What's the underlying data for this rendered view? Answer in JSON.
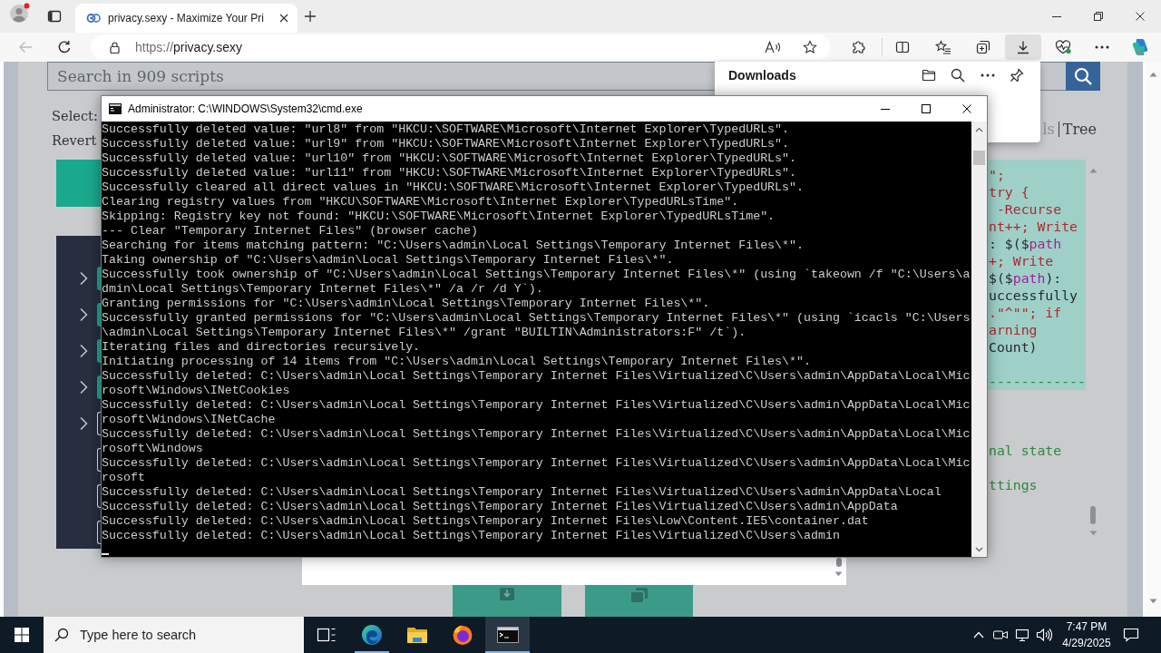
{
  "browser": {
    "tabs": [
      {
        "title": "privacy.sexy - Maximize Your Pri",
        "selected": true
      }
    ],
    "back_button": {
      "disabled": true
    },
    "address_bar": {
      "scheme": "https://",
      "host": "privacy.sexy"
    },
    "downloads_button": {
      "selected": true
    },
    "downloads_panel": {
      "title": "Downloads"
    }
  },
  "page": {
    "search": {
      "placeholder": "Search in 909 scripts"
    },
    "select_label": "Select:",
    "revert_label": "Revert",
    "view_options": [
      {
        "label": "ls",
        "selected": true
      },
      {
        "label": "Tree",
        "selected": false
      }
    ],
    "script_rows": [
      {
        "kind": "category",
        "checked": true
      },
      {
        "kind": "category",
        "checked": true
      },
      {
        "kind": "category",
        "checked": true
      },
      {
        "kind": "category",
        "checked": true
      },
      {
        "kind": "category",
        "checked": false
      },
      {
        "kind": "script",
        "checked": false
      },
      {
        "kind": "script",
        "checked": false
      },
      {
        "kind": "script",
        "checked": false
      }
    ],
    "code_lines": [
      {
        "kind": "code",
        "highlighted": true,
        "tokens": [
          {
            "text": "\";",
            "kind": "string"
          }
        ]
      },
      {
        "kind": "code",
        "highlighted": true,
        "tokens": [
          {
            "text": "try {",
            "kind": "string"
          }
        ]
      },
      {
        "kind": "code",
        "highlighted": true,
        "tokens": [
          {
            "text": " -Recurse",
            "kind": "string"
          }
        ]
      },
      {
        "kind": "code",
        "highlighted": true,
        "tokens": [
          {
            "text": "nt++; Write",
            "kind": "string"
          }
        ]
      },
      {
        "kind": "code",
        "highlighted": true,
        "tokens": [
          {
            "text": ": $($",
            "kind": "plain"
          },
          {
            "text": "path",
            "kind": "variable"
          }
        ]
      },
      {
        "kind": "code",
        "highlighted": true,
        "tokens": [
          {
            "text": "+; Write",
            "kind": "string"
          }
        ]
      },
      {
        "kind": "code",
        "highlighted": true,
        "tokens": [
          {
            "text": "$($",
            "kind": "plain"
          },
          {
            "text": "path",
            "kind": "variable"
          },
          {
            "text": "):",
            "kind": "plain"
          }
        ]
      },
      {
        "kind": "code",
        "highlighted": true,
        "tokens": [
          {
            "text": "uccessfully",
            "kind": "plain"
          }
        ]
      },
      {
        "kind": "code",
        "highlighted": true,
        "tokens": [
          {
            "text": ".\"^\"\"; if",
            "kind": "string"
          }
        ]
      },
      {
        "kind": "code",
        "highlighted": true,
        "tokens": [
          {
            "text": "arning",
            "kind": "string"
          }
        ]
      },
      {
        "kind": "code",
        "highlighted": true,
        "tokens": [
          {
            "text": "Count)",
            "kind": "plain"
          }
        ]
      },
      {
        "kind": "hidden",
        "highlighted": true
      },
      {
        "kind": "code",
        "highlighted": true,
        "tokens": [
          {
            "text": "------------",
            "kind": "comment"
          }
        ]
      },
      {
        "kind": "hidden",
        "highlighted": false
      },
      {
        "kind": "hidden",
        "highlighted": false
      },
      {
        "kind": "hidden",
        "highlighted": false
      },
      {
        "kind": "code",
        "highlighted": false,
        "tokens": [
          {
            "text": "nal state",
            "kind": "comment"
          }
        ]
      },
      {
        "kind": "hidden",
        "highlighted": false
      },
      {
        "kind": "code",
        "highlighted": false,
        "tokens": [
          {
            "text": "ttings",
            "kind": "comment"
          }
        ]
      }
    ]
  },
  "cmd_window": {
    "title": "Administrator: C:\\WINDOWS\\System32\\cmd.exe",
    "cursor_visible": true,
    "lines": [
      "Successfully deleted value: \"url8\" from \"HKCU:\\SOFTWARE\\Microsoft\\Internet Explorer\\TypedURLs\".",
      "Successfully deleted value: \"url9\" from \"HKCU:\\SOFTWARE\\Microsoft\\Internet Explorer\\TypedURLs\".",
      "Successfully deleted value: \"url10\" from \"HKCU:\\SOFTWARE\\Microsoft\\Internet Explorer\\TypedURLs\".",
      "Successfully deleted value: \"url11\" from \"HKCU:\\SOFTWARE\\Microsoft\\Internet Explorer\\TypedURLs\".",
      "Successfully cleared all direct values in \"HKCU:\\SOFTWARE\\Microsoft\\Internet Explorer\\TypedURLs\".",
      "Clearing registry values from \"HKCU\\SOFTWARE\\Microsoft\\Internet Explorer\\TypedURLsTime\".",
      "Skipping: Registry key not found: \"HKCU:\\SOFTWARE\\Microsoft\\Internet Explorer\\TypedURLsTime\".",
      "--- Clear \"Temporary Internet Files\" (browser cache)",
      "Searching for items matching pattern: \"C:\\Users\\admin\\Local Settings\\Temporary Internet Files\\*\".",
      "Taking ownership of \"C:\\Users\\admin\\Local Settings\\Temporary Internet Files\\*\".",
      "Successfully took ownership of \"C:\\Users\\admin\\Local Settings\\Temporary Internet Files\\*\" (using `takeown /f \"C:\\Users\\a",
      "dmin\\Local Settings\\Temporary Internet Files\\*\" /a /r /d Y`).",
      "Granting permissions for \"C:\\Users\\admin\\Local Settings\\Temporary Internet Files\\*\".",
      "Successfully granted permissions for \"C:\\Users\\admin\\Local Settings\\Temporary Internet Files\\*\" (using `icacls \"C:\\Users",
      "\\admin\\Local Settings\\Temporary Internet Files\\*\" /grant \"BUILTIN\\Administrators:F\" /t`).",
      "Iterating files and directories recursively.",
      "Initiating processing of 14 items from \"C:\\Users\\admin\\Local Settings\\Temporary Internet Files\\*\".",
      "Successfully deleted: C:\\Users\\admin\\Local Settings\\Temporary Internet Files\\Virtualized\\C\\Users\\admin\\AppData\\Local\\Mic",
      "rosoft\\Windows\\INetCookies",
      "Successfully deleted: C:\\Users\\admin\\Local Settings\\Temporary Internet Files\\Virtualized\\C\\Users\\admin\\AppData\\Local\\Mic",
      "rosoft\\Windows\\INetCache",
      "Successfully deleted: C:\\Users\\admin\\Local Settings\\Temporary Internet Files\\Virtualized\\C\\Users\\admin\\AppData\\Local\\Mic",
      "rosoft\\Windows",
      "Successfully deleted: C:\\Users\\admin\\Local Settings\\Temporary Internet Files\\Virtualized\\C\\Users\\admin\\AppData\\Local\\Mic",
      "rosoft",
      "Successfully deleted: C:\\Users\\admin\\Local Settings\\Temporary Internet Files\\Virtualized\\C\\Users\\admin\\AppData\\Local",
      "Successfully deleted: C:\\Users\\admin\\Local Settings\\Temporary Internet Files\\Virtualized\\C\\Users\\admin\\AppData",
      "Successfully deleted: C:\\Users\\admin\\Local Settings\\Temporary Internet Files\\Low\\Content.IE5\\container.dat",
      "Successfully deleted: C:\\Users\\admin\\Local Settings\\Temporary Internet Files\\Virtualized\\C\\Users\\admin"
    ]
  },
  "taskbar": {
    "search": {
      "placeholder": "Type here to search"
    },
    "apps": [
      {
        "kind": "task_view",
        "running": false,
        "selected": false
      },
      {
        "kind": "browser",
        "running": true,
        "selected": false
      },
      {
        "kind": "folder",
        "running": false,
        "selected": false
      },
      {
        "kind": "fox_browser",
        "running": false,
        "selected": false
      },
      {
        "kind": "terminal",
        "running": true,
        "selected": true
      }
    ],
    "clock": {
      "time": "7:47 PM",
      "date": "4/29/2025"
    }
  }
}
